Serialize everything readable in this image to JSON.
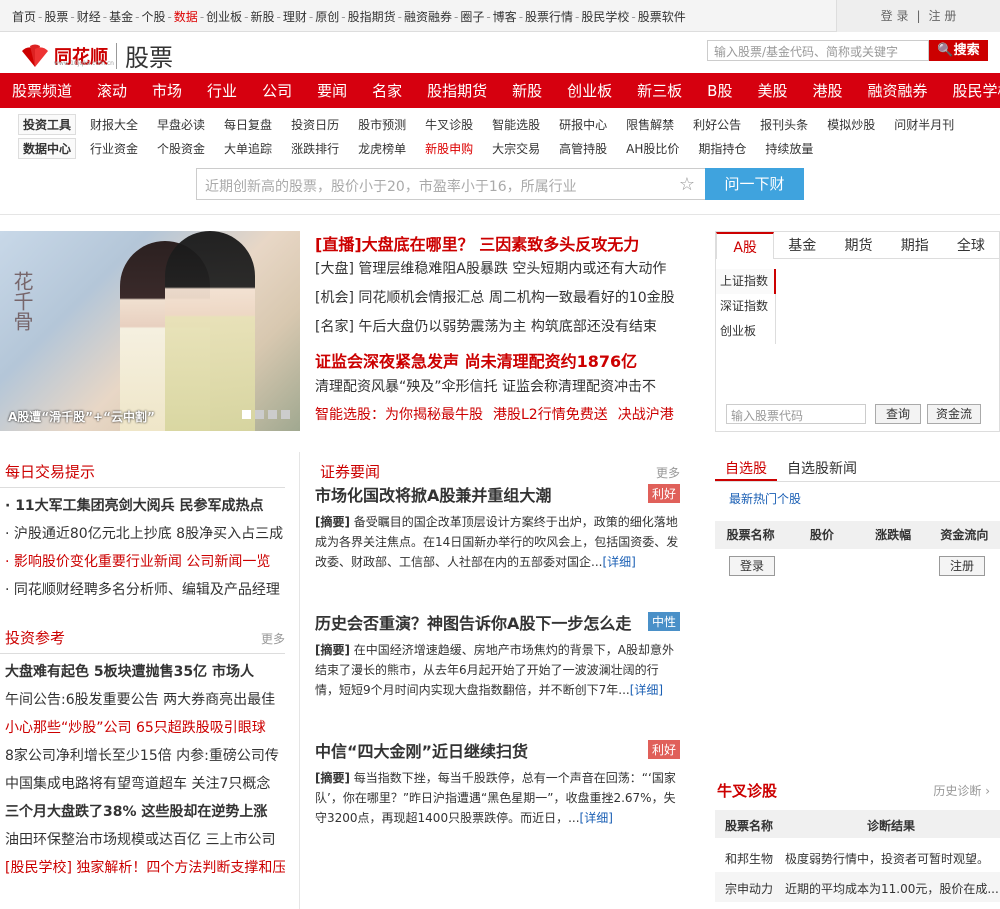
{
  "topbar": {
    "links": [
      "首页",
      "股票",
      "财经",
      "基金",
      "个股",
      "数据",
      "创业板",
      "新股",
      "理财",
      "原创",
      "股指期货",
      "融资融券",
      "圈子",
      "博客",
      "股票行情",
      "股民学校",
      "股票软件"
    ],
    "highlight_index": 5,
    "login": "登 录",
    "register": "注 册"
  },
  "header": {
    "logo_text": "同花顺",
    "logo_sub": "www.10jqka.com.cn",
    "section_title": "股票",
    "search_placeholder": "输入股票/基金代码、简称或关键字",
    "search_button": "搜索"
  },
  "nav": {
    "items": [
      "股票频道",
      "滚动",
      "市场",
      "行业",
      "公司",
      "要闻",
      "名家",
      "股指期货",
      "新股",
      "创业板",
      "新三板",
      "B股",
      "美股",
      "港股",
      "融资融券",
      "股民学校"
    ]
  },
  "subnav": {
    "tools_tag": "投资工具",
    "tools": [
      "财报大全",
      "早盘必读",
      "每日复盘",
      "投资日历",
      "股市预测",
      "牛叉诊股",
      "智能选股",
      "研报中心",
      "限售解禁",
      "利好公告",
      "报刊头条",
      "模拟炒股",
      "问财半月刊"
    ],
    "data_tag": "数据中心",
    "data": [
      "行业资金",
      "个股资金",
      "大单追踪",
      "涨跌排行",
      "龙虎榜单",
      "新股申购",
      "大宗交易",
      "高管持股",
      "AH股比价",
      "期指持仓",
      "持续放量"
    ],
    "data_red_index": 5
  },
  "ask": {
    "placeholder": "近期创新高的股票，股价小于20，市盈率小于16，所属行业",
    "button": "问一下财"
  },
  "banner": {
    "caption": "A股遭“滑千股”+“云中割”",
    "calligraphy": "花千骨",
    "slide_count": 4,
    "active_slide": 1
  },
  "headlines": {
    "h1": "[直播]大盘底在哪里？ 三因素致多头反攻无力",
    "lines1": [
      "[大盘] 管理层维稳难阻A股暴跌 空头短期内或还有大动作",
      "[机会] 同花顺机会情报汇总 周二机构一致最看好的10金股",
      "[名家] 午后大盘仍以弱势震荡为主 构筑底部还没有结束"
    ],
    "h2": "证监会深夜紧急发声 尚未清理配资约1876亿",
    "line2": "清理配资风暴“殃及”伞形信托 证监会称清理配资冲击不",
    "line3": [
      "智能选股：为你揭秘最牛股",
      "港股L2行情免费送",
      "决战沪港"
    ]
  },
  "market": {
    "tabs": [
      "A股",
      "基金",
      "期货",
      "期指",
      "全球"
    ],
    "side": [
      "上证指数",
      "深证指数",
      "创业板"
    ],
    "input_placeholder": "输入股票代码",
    "query_button": "查询",
    "flow_button": "资金流"
  },
  "daily": {
    "title": "每日交易提示",
    "items": [
      {
        "text": "· 11大军工集团亮剑大阅兵 民参军成热点",
        "style": "b"
      },
      {
        "text": "· 沪股通近80亿元北上抄底 8股净买入占三成",
        "style": ""
      },
      {
        "text": "· 影响股价变化重要行业新闻 公司新闻一览",
        "style": "red"
      },
      {
        "text": "· 同花顺财经聘多名分析师、编辑及产品经理",
        "style": ""
      }
    ]
  },
  "invest": {
    "title": "投资参考",
    "more": "更多",
    "lines": [
      {
        "parts": [
          "大盘难有起色 5板块遭抛售35亿 市场人"
        ],
        "style": "b",
        "red": []
      },
      {
        "parts": [
          "午间公告:6股发重要公告 两大券商亮出最佳"
        ],
        "style": "",
        "red": []
      },
      {
        "parts": [
          "小心那些“炒股”公司 65只超跌股吸引眼球"
        ],
        "style": "",
        "red": [
          0
        ]
      },
      {
        "parts": [
          "8家公司净利增长至少15倍 内参:重磅公司传"
        ],
        "style": "",
        "red": []
      },
      {
        "parts": [
          "中国集成电路将有望弯道超车 关注7只概念"
        ],
        "style": "",
        "red": []
      },
      {
        "parts": [
          "三个月大盘跌了38% 这些股却在逆势上涨"
        ],
        "style": "b",
        "red": []
      },
      {
        "parts": [
          "油田环保整治市场规模或达百亿 三上市公司"
        ],
        "style": "",
        "red": []
      },
      {
        "parts": [
          "[股民学校] 独家解析！四个方法判断支撑和压"
        ],
        "style": "",
        "red": [
          0
        ]
      }
    ]
  },
  "securities": {
    "title": "证券要闻",
    "more": "更多",
    "articles": [
      {
        "title": "市场化国改将掀A股兼并重组大潮",
        "badge": "利好",
        "badge_color": "#e0605a",
        "summary_tag": "[摘要]",
        "summary": " 备受瞩目的国企改革顶层设计方案终于出炉，政策的细化落地成为各界关注焦点。在14日国新办举行的吹风会上，包括国资委、发改委、财政部、工信部、人社部在内的五部委对国企...",
        "detail": "[详细]"
      },
      {
        "title": "历史会否重演？神图告诉你A股下一步怎么走",
        "badge": "中性",
        "badge_color": "#4a90c8",
        "summary_tag": "[摘要]",
        "summary": " 在中国经济增速趋缓、房地产市场焦灼的背景下，A股却意外结束了漫长的熊市，从去年6月起开始了开始了一波波澜壮阔的行情，短短9个月时间内实现大盘指数翻倍，并不断创下7年...",
        "detail": "[详细]"
      },
      {
        "title": "中信“四大金刚”近日继续扫货",
        "badge": "利好",
        "badge_color": "#e0605a",
        "summary_tag": "[摘要]",
        "summary": " 每当指数下挫，每当千股跌停，总有一个声音在回荡：“‘国家队’，你在哪里？”昨日沪指遭遇“黑色星期一”，收盘重挫2.67%，失守3200点，再现超1400只股票跌停。而近日，...",
        "detail": "[详细]"
      }
    ]
  },
  "watch": {
    "tabs": [
      "自选股",
      "自选股新闻"
    ],
    "hot": "最新热门个股",
    "cols": [
      "股票名称",
      "股价",
      "涨跌幅",
      "资金流向"
    ],
    "login": "登录",
    "register": "注册"
  },
  "diag": {
    "title": "牛叉诊股",
    "more": "历史诊断",
    "cols": [
      "股票名称",
      "诊断结果"
    ],
    "rows": [
      {
        "name": "和邦生物",
        "result": "极度弱势行情中，投资者可暂时观望。"
      },
      {
        "name": "宗申动力",
        "result": "近期的平均成本为11.00元，股价在成..."
      }
    ]
  },
  "colors": {
    "brand_red": "#d6000f",
    "link_blue": "#1a5fb4",
    "ask_blue": "#3fa3de"
  }
}
